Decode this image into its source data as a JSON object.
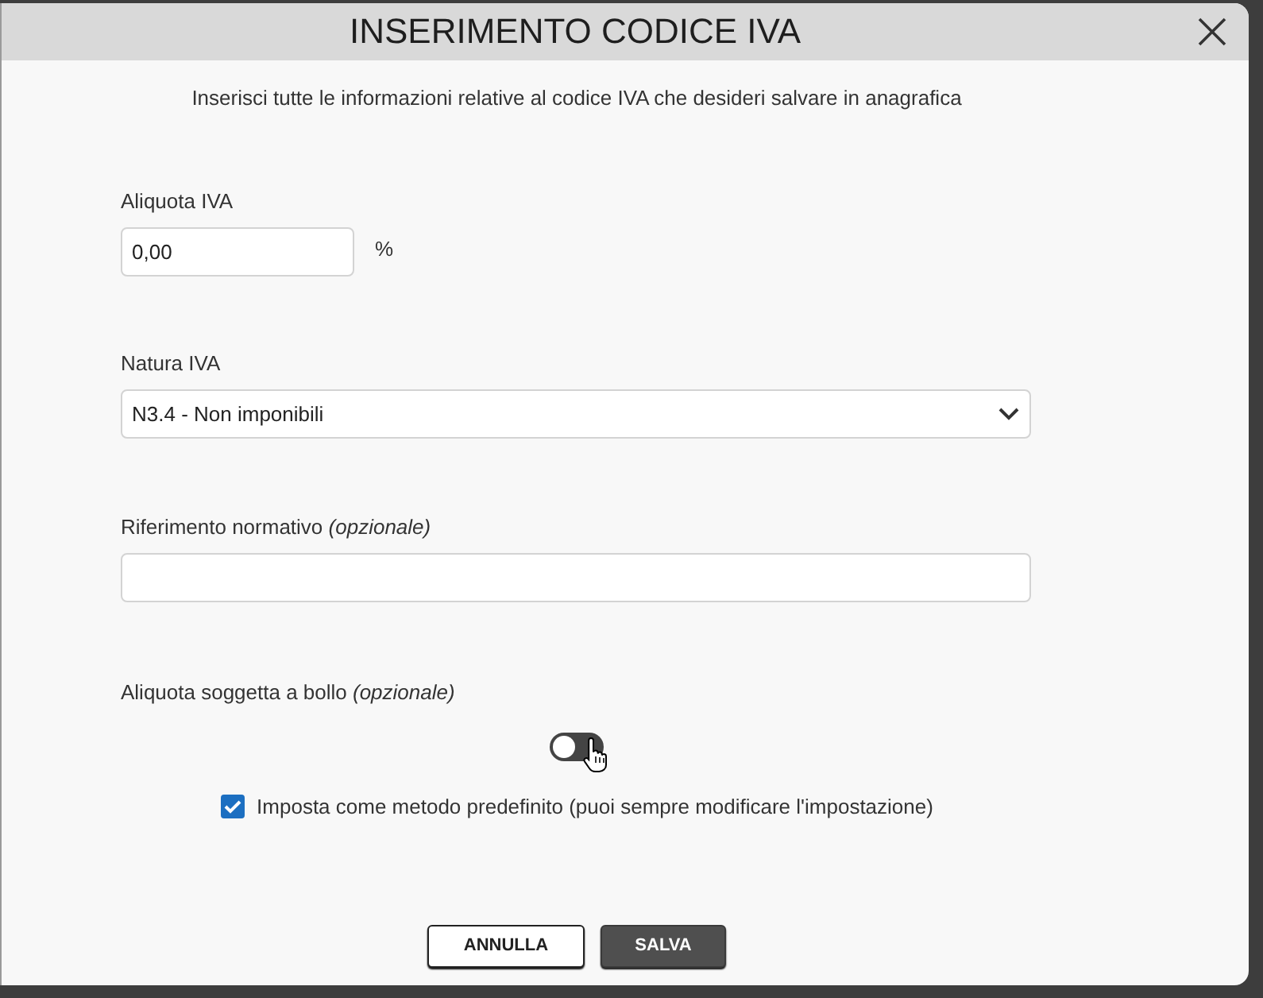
{
  "dialog": {
    "title": "INSERIMENTO CODICE IVA",
    "intro": "Inserisci tutte le informazioni relative al codice IVA che desideri salvare in anagrafica"
  },
  "fields": [
    {
      "kind": "number",
      "label": "Aliquota IVA",
      "value": "0,00",
      "unit": "%"
    },
    {
      "kind": "select",
      "label": "Natura IVA",
      "value": "N3.4 - Non imponibili"
    },
    {
      "kind": "text",
      "label": "Riferimento normativo *(opzionale)*"
    },
    {
      "kind": "toggle",
      "label": "Aliquota soggetta a bollo *(opzionale)*",
      "on": false
    }
  ],
  "default_option": {
    "label": "Imposta come metodo predefinito (puoi sempre modificare l'impostazione)",
    "checked": true
  },
  "buttons": [
    {
      "label": "ANNULLA",
      "kind": "secondary"
    },
    {
      "label": "SALVA",
      "kind": "primary"
    }
  ]
}
